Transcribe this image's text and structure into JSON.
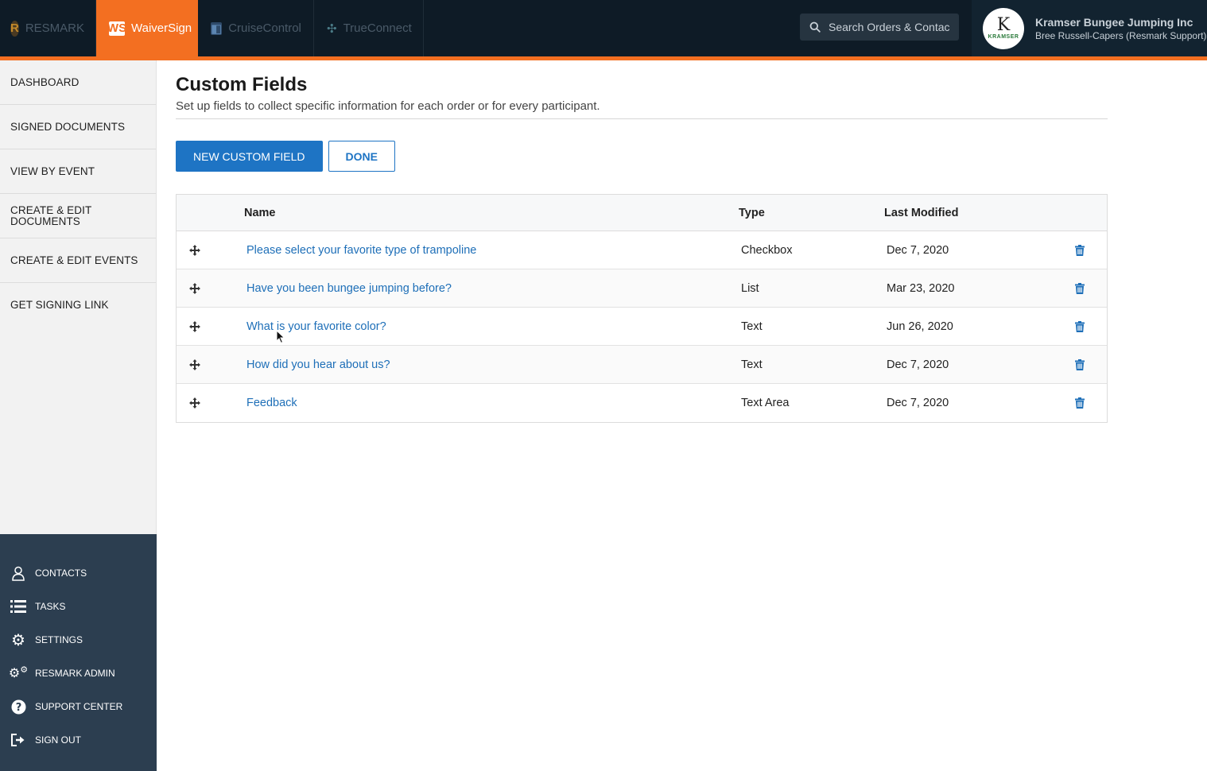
{
  "topbar": {
    "apps": [
      {
        "label": "RESMARK",
        "icon": "resmark-logo-icon",
        "active": false
      },
      {
        "label": "WaiverSign",
        "icon": "waiversign-logo-icon",
        "active": true
      },
      {
        "label": "CruiseControl",
        "icon": "cruisecontrol-logo-icon",
        "active": false
      },
      {
        "label": "TrueConnect",
        "icon": "trueconnect-logo-icon",
        "active": false
      }
    ],
    "search": {
      "placeholder": "Search Orders & Contac",
      "icon": "search-icon"
    },
    "account": {
      "company": "Kramser Bungee Jumping Inc",
      "user": "Bree Russell-Capers (Resmark Support)",
      "avatar_letter": "K",
      "avatar_word": "KRAMSER"
    },
    "accent_color": "#f36f21"
  },
  "sidebar": {
    "items": [
      {
        "label": "DASHBOARD"
      },
      {
        "label": "SIGNED DOCUMENTS"
      },
      {
        "label": "VIEW BY EVENT"
      },
      {
        "label": "CREATE & EDIT DOCUMENTS"
      },
      {
        "label": "CREATE & EDIT EVENTS"
      },
      {
        "label": "GET SIGNING LINK"
      }
    ],
    "bottom_items": [
      {
        "label": "CONTACTS",
        "icon": "user-icon"
      },
      {
        "label": "TASKS",
        "icon": "list-icon"
      },
      {
        "label": "SETTINGS",
        "icon": "gear-icon"
      },
      {
        "label": "RESMARK ADMIN",
        "icon": "gears-icon"
      },
      {
        "label": "SUPPORT CENTER",
        "icon": "question-icon"
      },
      {
        "label": "SIGN OUT",
        "icon": "sign-out-icon"
      }
    ]
  },
  "main": {
    "title": "Custom Fields",
    "subtitle": "Set up fields to collect specific information for each order or for every participant.",
    "new_button": "NEW CUSTOM FIELD",
    "done_button": "DONE",
    "table": {
      "headers": {
        "name": "Name",
        "type": "Type",
        "last_modified": "Last Modified"
      },
      "rows": [
        {
          "name": "Please select your favorite type of trampoline",
          "type": "Checkbox",
          "last_modified": "Dec 7, 2020"
        },
        {
          "name": "Have you been bungee jumping before?",
          "type": "List",
          "last_modified": "Mar 23, 2020"
        },
        {
          "name": "What is your favorite color?",
          "type": "Text",
          "last_modified": "Jun 26, 2020"
        },
        {
          "name": "How did you hear about us?",
          "type": "Text",
          "last_modified": "Dec 7, 2020"
        },
        {
          "name": "Feedback",
          "type": "Text Area",
          "last_modified": "Dec 7, 2020"
        }
      ]
    },
    "link_color": "#1e6fb8",
    "button_color": "#1e74c4"
  }
}
